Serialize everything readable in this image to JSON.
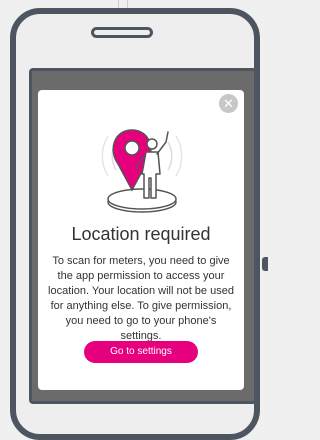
{
  "modal": {
    "close_symbol": "✕",
    "title": "Location required",
    "message": "To scan for meters, you need to give the app permission to access your location. Your location will not be used for anything else. To give permission, you need to go to your phone's settings.",
    "button_label": "Go to settings",
    "illustration_icon": "location-pin-person-icon"
  },
  "colors": {
    "accent": "#e6007e",
    "frame": "#4d5660",
    "overlay": "#6b6b6b",
    "close_button": "#c7c7c7"
  }
}
